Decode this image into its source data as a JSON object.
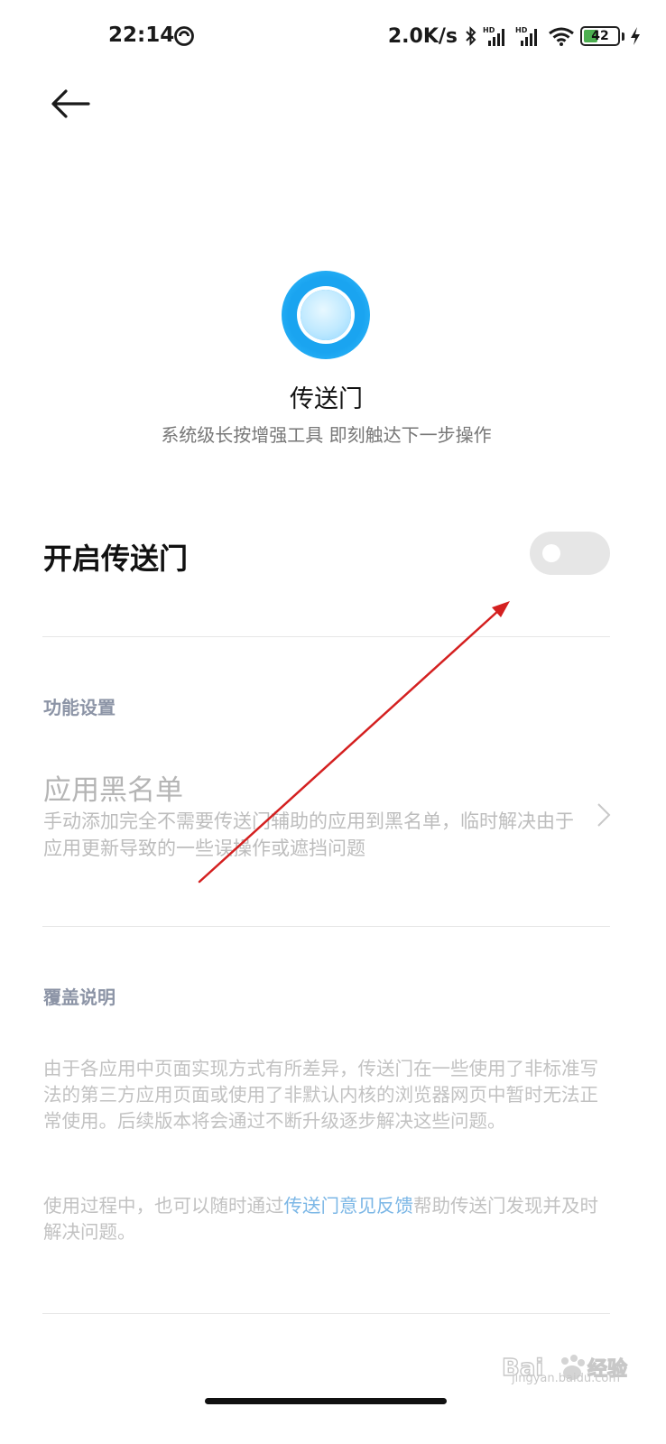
{
  "status_bar": {
    "time": "22:14",
    "network_speed": "2.0K/s",
    "battery_level": "42",
    "battery_percent": 42,
    "icons": [
      "do-not-disturb-icon",
      "bluetooth-icon",
      "hd-signal-icon",
      "hd-signal-icon",
      "wifi-icon",
      "battery-icon",
      "charging-icon"
    ]
  },
  "header": {
    "app_name": "传送门",
    "subtitle": "系统级长按增强工具 即刻触达下一步操作"
  },
  "toggle": {
    "label": "开启传送门",
    "enabled": false
  },
  "features": {
    "section_title": "功能设置",
    "blacklist": {
      "title": "应用黑名单",
      "description": "手动添加完全不需要传送门辅助的应用到黑名单，临时解决由于应用更新导致的一些误操作或遮挡问题"
    }
  },
  "coverage": {
    "section_title": "覆盖说明",
    "paragraph1": "由于各应用中页面实现方式有所差异，传送门在一些使用了非标准写法的第三方应用页面或使用了非默认内核的浏览器网页中暂时无法正常使用。后续版本将会通过不断升级逐步解决这些问题。",
    "paragraph2_prefix": "使用过程中，也可以随时通过",
    "feedback_link": "传送门意见反馈",
    "paragraph2_suffix": "帮助传送门发现并及时解决问题。"
  },
  "watermark": {
    "text": "jingyan.baidu.com"
  },
  "colors": {
    "accent_blue": "#1aa4f0",
    "link_blue": "#7cb7e6",
    "section_gray": "#8c94a6",
    "annotation_red": "#d42020",
    "switch_off": "#e6e6e6"
  }
}
